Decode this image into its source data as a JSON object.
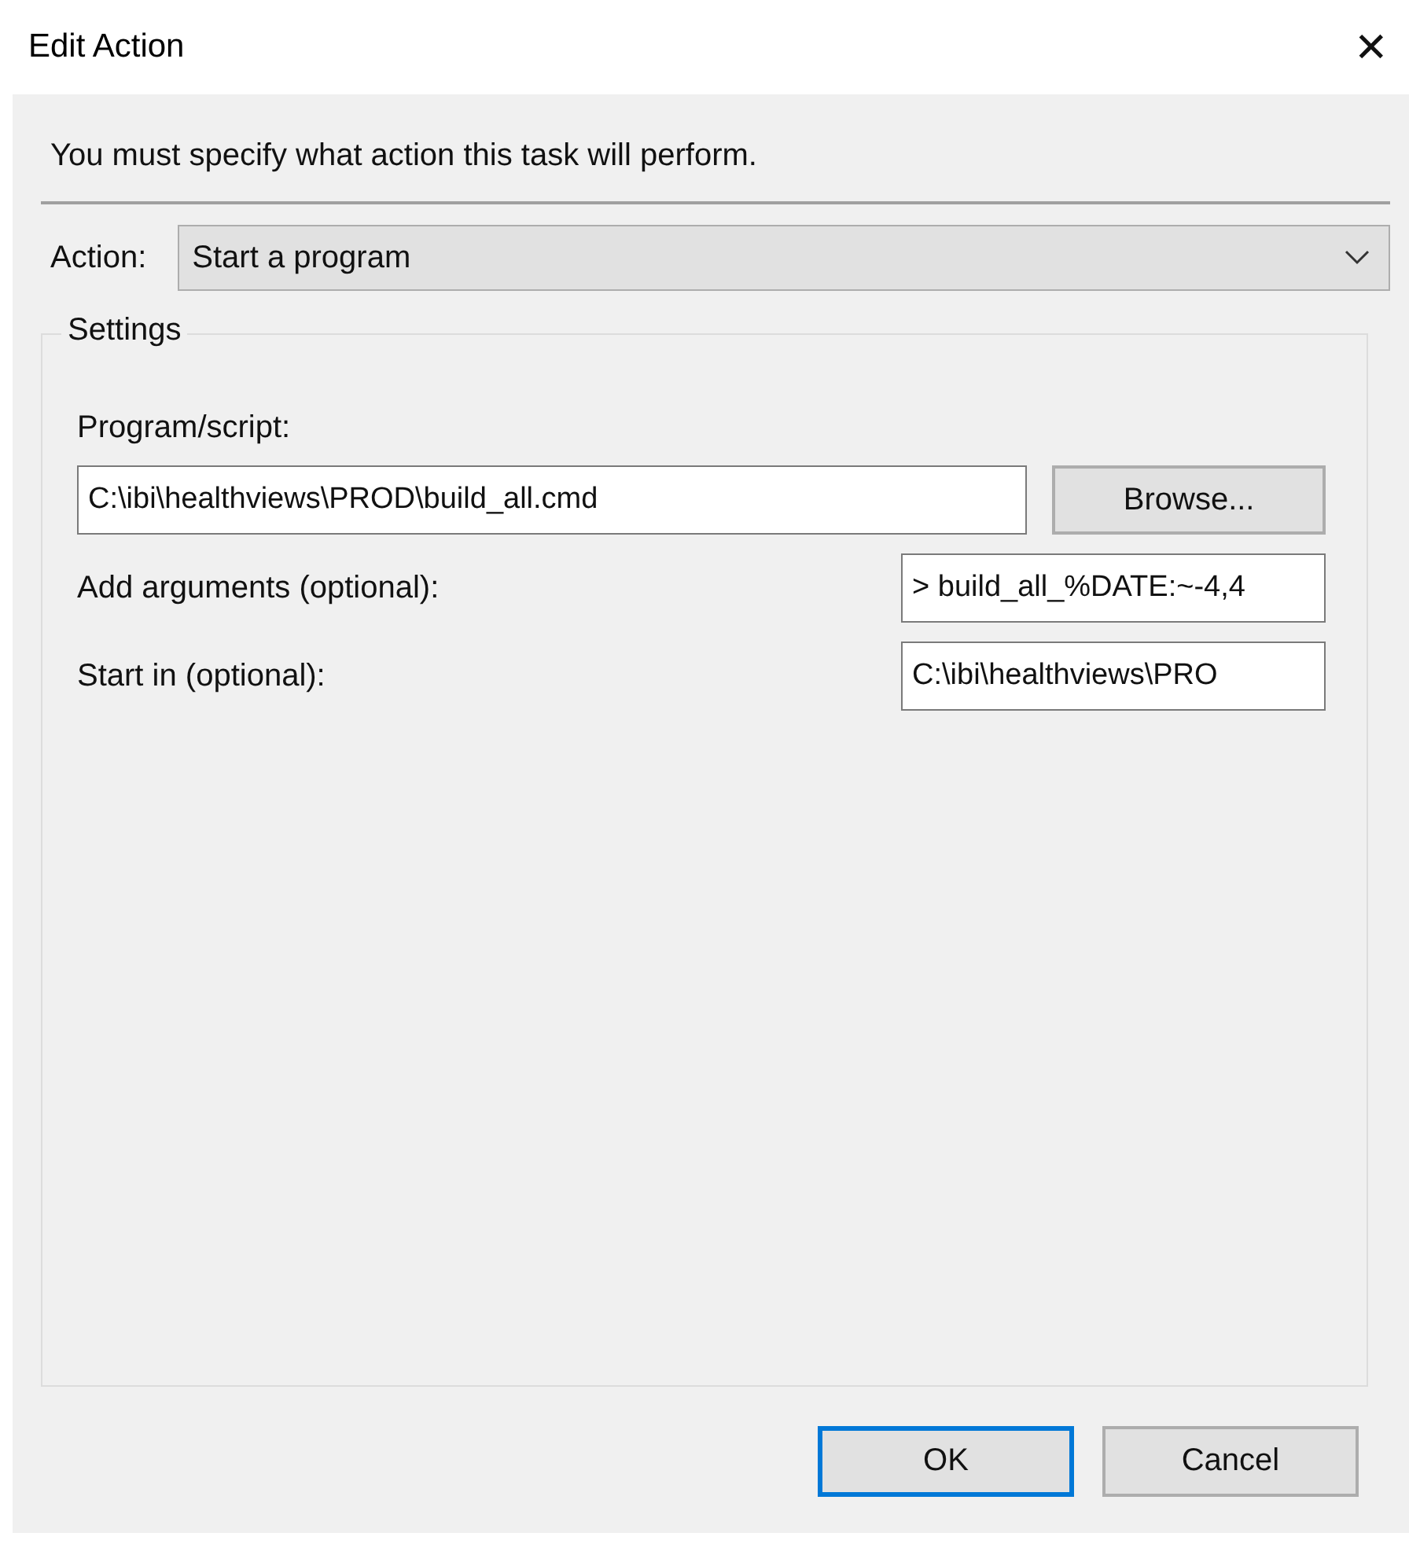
{
  "window": {
    "title": "Edit Action",
    "close": "✕"
  },
  "instruction": "You must specify what action this task will perform.",
  "action": {
    "label": "Action:",
    "value": "Start a program"
  },
  "settings": {
    "title": "Settings",
    "program": {
      "label": "Program/script:",
      "value": "C:\\ibi\\healthviews\\PROD\\build_all.cmd",
      "button": "Browse..."
    },
    "arguments": {
      "label": "Add arguments (optional):",
      "value": "> build_all_%DATE:~-4,4"
    },
    "start_in": {
      "label": "Start in (optional):",
      "value": "C:\\ibi\\healthviews\\PRO"
    }
  },
  "buttons": [
    {
      "label": "OK",
      "default": true
    },
    {
      "label": "Cancel",
      "default": false
    }
  ]
}
